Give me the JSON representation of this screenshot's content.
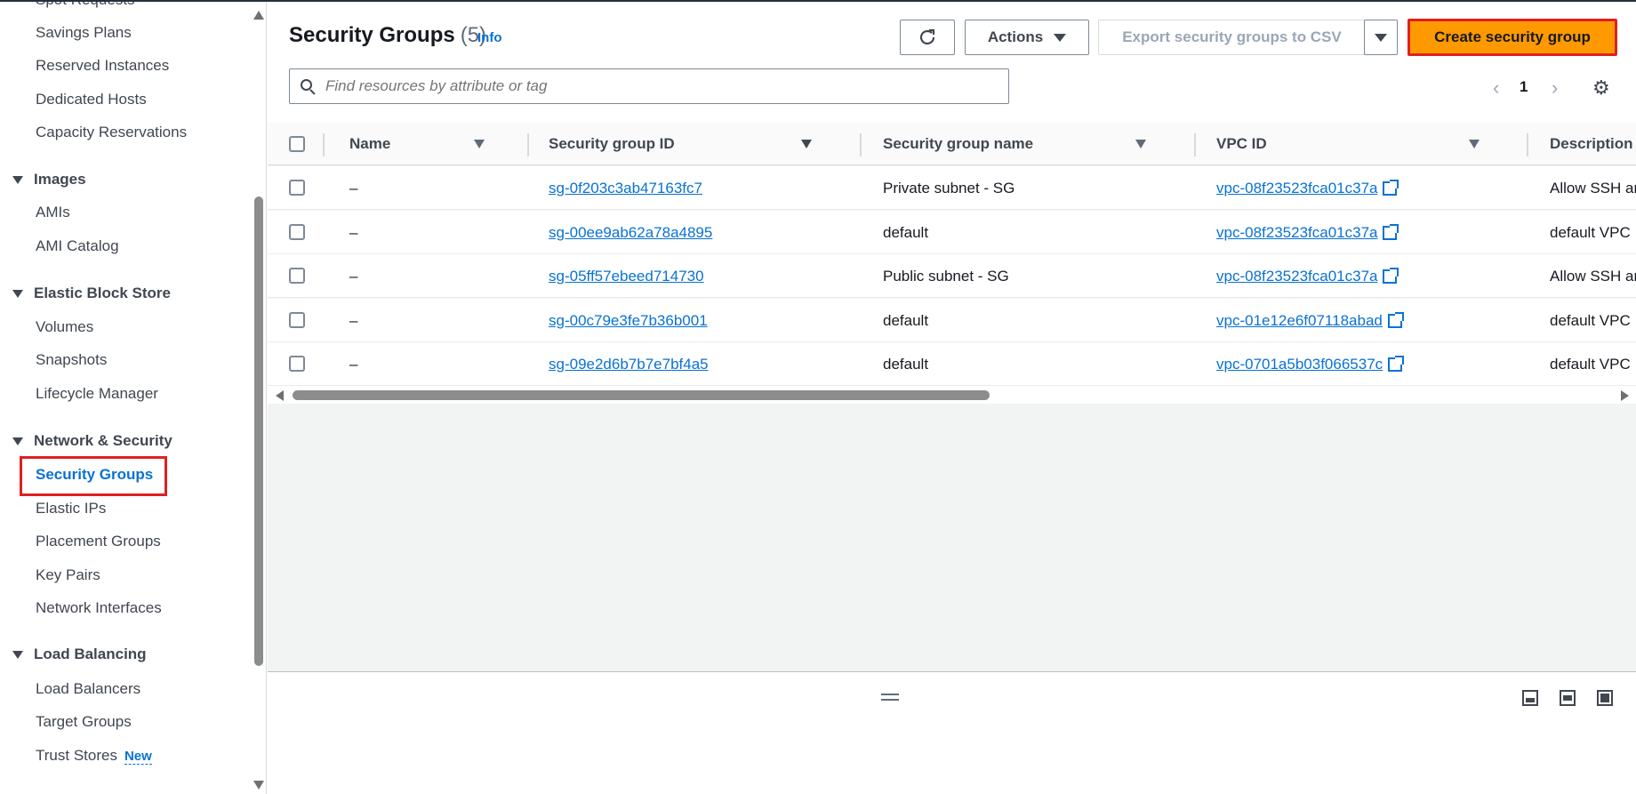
{
  "sidebar": {
    "items_top": [
      "Spot Requests",
      "Savings Plans",
      "Reserved Instances",
      "Dedicated Hosts",
      "Capacity Reservations"
    ],
    "images": {
      "heading": "Images",
      "items": [
        "AMIs",
        "AMI Catalog"
      ]
    },
    "ebs": {
      "heading": "Elastic Block Store",
      "items": [
        "Volumes",
        "Snapshots",
        "Lifecycle Manager"
      ]
    },
    "network": {
      "heading": "Network & Security",
      "items": [
        "Security Groups",
        "Elastic IPs",
        "Placement Groups",
        "Key Pairs",
        "Network Interfaces"
      ]
    },
    "lb": {
      "heading": "Load Balancing",
      "items": [
        "Load Balancers",
        "Target Groups",
        "Trust Stores"
      ],
      "new_badge": "New"
    }
  },
  "header": {
    "title": "Security Groups",
    "count": "(5)",
    "info": "Info",
    "actions_label": "Actions",
    "export_label": "Export security groups to CSV",
    "create_label": "Create security group"
  },
  "search": {
    "placeholder": "Find resources by attribute or tag"
  },
  "pagination": {
    "page": "1"
  },
  "table": {
    "columns": [
      "Name",
      "Security group ID",
      "Security group name",
      "VPC ID",
      "Description"
    ],
    "rows": [
      {
        "name": "–",
        "sg_id": "sg-0f203c3ab47163fc7",
        "sg_name": "Private subnet - SG",
        "vpc_id": "vpc-08f23523fca01c37a",
        "description": "Allow SSH ar"
      },
      {
        "name": "–",
        "sg_id": "sg-00ee9ab62a78a4895",
        "sg_name": "default",
        "vpc_id": "vpc-08f23523fca01c37a",
        "description": "default VPC"
      },
      {
        "name": "–",
        "sg_id": "sg-05ff57ebeed714730",
        "sg_name": "Public subnet - SG",
        "vpc_id": "vpc-08f23523fca01c37a",
        "description": "Allow SSH ar"
      },
      {
        "name": "–",
        "sg_id": "sg-00c79e3fe7b36b001",
        "sg_name": "default",
        "vpc_id": "vpc-01e12e6f07118abad",
        "description": "default VPC"
      },
      {
        "name": "–",
        "sg_id": "sg-09e2d6b7b7e7bf4a5",
        "sg_name": "default",
        "vpc_id": "vpc-0701a5b03f066537c",
        "description": "default VPC"
      }
    ]
  },
  "colors": {
    "accent": "#0972d3",
    "primary_button": "#ff9900",
    "highlight": "#e02020"
  }
}
